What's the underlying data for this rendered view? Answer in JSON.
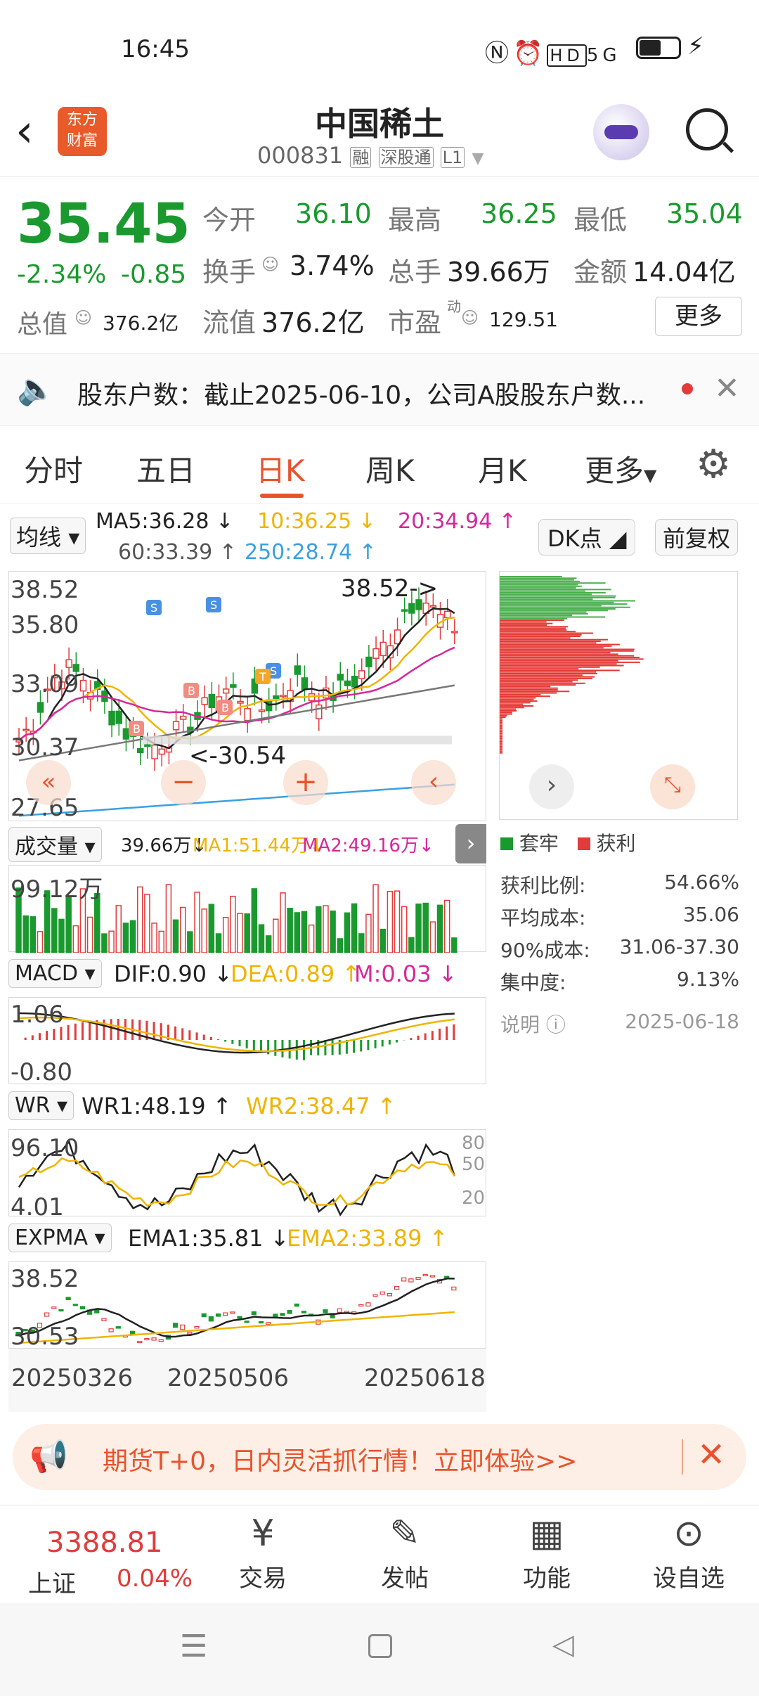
{
  "status_bar": {
    "time": "16:45",
    "signal": "5G"
  },
  "header": {
    "title": "中国稀土",
    "code": "000831",
    "tags": [
      "融",
      "深股通",
      "L1"
    ],
    "logo_text": [
      "东方",
      "财富"
    ]
  },
  "quote": {
    "price": "35.45",
    "change_pct": "-2.34%",
    "change": "-0.85",
    "open_label": "今开",
    "open": "36.10",
    "high_label": "最高",
    "high": "36.25",
    "low_label": "最低",
    "low": "35.04",
    "turnover_label": "换手",
    "turnover": "3.74%",
    "volume_label": "总手",
    "volume": "39.66万",
    "amount_label": "金额",
    "amount": "14.04亿",
    "total_cap_label": "总值",
    "total_cap": "376.2亿",
    "float_cap_label": "流值",
    "float_cap": "376.2亿",
    "pe_label": "市盈",
    "pe_sup": "动",
    "pe": "129.51",
    "more_button": "更多"
  },
  "notice": {
    "text": "股东户数：截止2025-06-10，公司A股股东户数..."
  },
  "tabs": [
    "分时",
    "五日",
    "日K",
    "周K",
    "月K",
    "更多"
  ],
  "active_tab": "日K",
  "ma_legend": {
    "selector": "均线",
    "ma5": "MA5:36.28",
    "ma10": "10:36.25",
    "ma20": "20:34.94",
    "ma60": "60:33.39",
    "ma250": "250:28.74",
    "dk_button": "DK点",
    "adjust_button": "前复权"
  },
  "kline": {
    "y_labels": [
      "38.52",
      "35.80",
      "33.09",
      "30.37",
      "27.65"
    ],
    "max_marker": "38.52->",
    "min_marker": "<-30.54",
    "signals": [
      "S",
      "S",
      "S",
      "B",
      "B",
      "B",
      "T"
    ]
  },
  "volume": {
    "selector": "成交量",
    "value": "39.66万",
    "ma1": "MA1:51.44万",
    "ma2": "MA2:49.16万",
    "y_label": "99.12万"
  },
  "macd": {
    "selector": "MACD",
    "dif": "DIF:0.90",
    "dea": "DEA:0.89",
    "m": "M:0.03",
    "y_labels": [
      "1.06",
      "-0.80"
    ]
  },
  "wr": {
    "selector": "WR",
    "wr1": "WR1:48.19",
    "wr2": "WR2:38.47",
    "y_labels": [
      "96.10",
      "4.01"
    ],
    "ref_labels": [
      "80",
      "50",
      "20"
    ]
  },
  "expma": {
    "selector": "EXPMA",
    "ema1": "EMA1:35.81",
    "ema2": "EMA2:33.89",
    "y_labels": [
      "38.52",
      "30.53"
    ]
  },
  "x_labels": [
    "20250326",
    "20250506",
    "20250618"
  ],
  "chip_distribution": {
    "legend_trapped": "套牢",
    "legend_profit": "获利",
    "profit_ratio_label": "获利比例:",
    "profit_ratio": "54.66%",
    "avg_cost_label": "平均成本:",
    "avg_cost": "35.06",
    "cost90_label": "90%成本:",
    "cost90": "31.06-37.30",
    "concentration_label": "集中度:",
    "concentration": "9.13%",
    "explain_label": "说明",
    "date": "2025-06-18"
  },
  "ad": {
    "text": "期货T+0，日内灵活抓行情！立即体验>>"
  },
  "bottom_nav": {
    "index_value": "3388.81",
    "index_name": "上证",
    "index_change": "0.04%",
    "items": [
      "交易",
      "发帖",
      "功能",
      "设自选"
    ]
  },
  "colors": {
    "up": "#e23b3b",
    "down": "#1a9a2e",
    "accent": "#e8532c",
    "ma5": "#222222",
    "ma10": "#f0b400",
    "ma20": "#d6289a",
    "ma60": "#777777",
    "ma250": "#3aa0e0"
  }
}
